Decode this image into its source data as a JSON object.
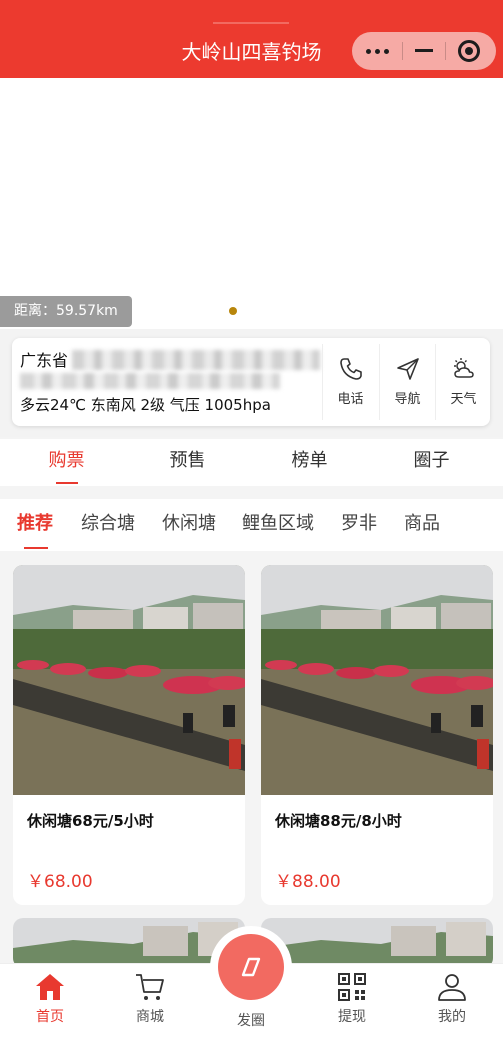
{
  "header": {
    "title": "大岭山四喜钓场"
  },
  "banner": {
    "distance": "距离：59.57km"
  },
  "info": {
    "address_prefix": "广东省",
    "weather": "多云24℃  东南风 2级  气压 1005hpa",
    "actions": [
      {
        "label": "电话",
        "icon": "phone-icon"
      },
      {
        "label": "导航",
        "icon": "navigation-icon"
      },
      {
        "label": "天气",
        "icon": "weather-icon"
      }
    ]
  },
  "tabs": [
    {
      "label": "购票"
    },
    {
      "label": "预售"
    },
    {
      "label": "榜单"
    },
    {
      "label": "圈子"
    }
  ],
  "subtabs": [
    {
      "label": "推荐"
    },
    {
      "label": "综合塘"
    },
    {
      "label": "休闲塘"
    },
    {
      "label": "鲤鱼区域"
    },
    {
      "label": "罗非"
    },
    {
      "label": "商品"
    }
  ],
  "products": [
    {
      "title": "休闲塘68元/5小时",
      "price": "￥68.00"
    },
    {
      "title": "休闲塘88元/8小时",
      "price": "￥88.00"
    }
  ],
  "nav": {
    "items": [
      {
        "label": "首页"
      },
      {
        "label": "商城"
      },
      {
        "label": "发圈"
      },
      {
        "label": "提现"
      },
      {
        "label": "我的"
      }
    ]
  },
  "colors": {
    "brand": "#ec3a2f",
    "accent": "#e8392f",
    "fab": "#f26a61"
  }
}
